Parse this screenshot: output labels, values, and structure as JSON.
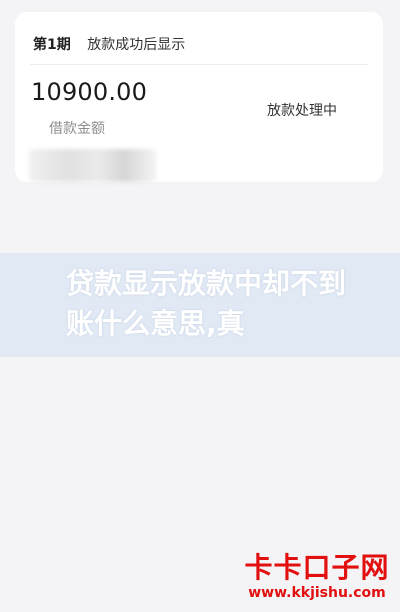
{
  "loan_card": {
    "period_label": "第1期",
    "period_desc": "放款成功后显示",
    "amount": "10900.00",
    "amount_label": "借款金额",
    "status": "放款处理中"
  },
  "banner": {
    "text": "贷款显示放款中却不到账什么意思,真"
  },
  "watermark": {
    "title": "卡卡口子网",
    "url": "www.kkjishu.com"
  }
}
